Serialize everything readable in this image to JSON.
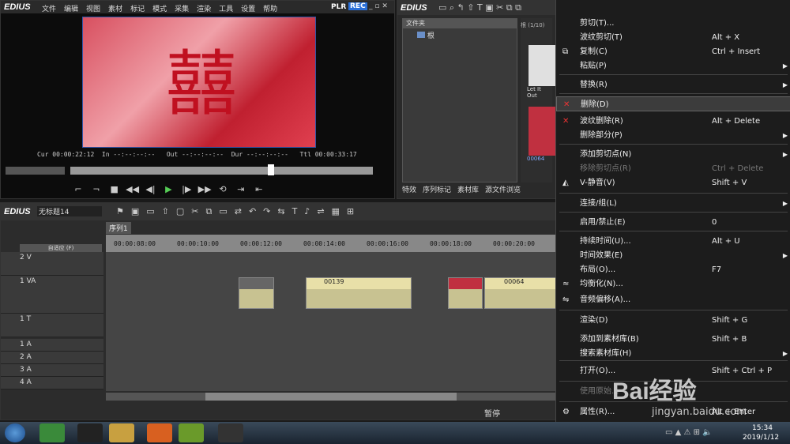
{
  "app": {
    "name": "EDIUS",
    "menus": [
      "文件",
      "编辑",
      "视图",
      "素材",
      "标记",
      "模式",
      "采集",
      "渲染",
      "工具",
      "设置",
      "帮助"
    ],
    "mode_plr": "PLR",
    "mode_rec": "REC"
  },
  "player": {
    "cur_label": "Cur",
    "cur": "00:00:22:12",
    "in_label": "In",
    "in": "--:--:--:--",
    "out_label": "Out",
    "out": "--:--:--:--",
    "dur_label": "Dur",
    "dur": "--:--:--:--",
    "ttl_label": "Ttl",
    "ttl": "00:00:33:17"
  },
  "bin": {
    "title": "EDIUS",
    "folder_header": "文件夹",
    "root": "根",
    "clip_header": "根 (1/10)",
    "clip1_label": "Let It Out",
    "clip2_label": "00064",
    "tabs": [
      "特效",
      "序列标记",
      "素材库",
      "源文件浏览"
    ]
  },
  "timeline": {
    "title": "EDIUS",
    "project": "无标题14",
    "sequence_tab": "序列1",
    "zoom": "自适应 (F)",
    "ruler": [
      "00:00:08:00",
      "00:00:10:00",
      "00:00:12:00",
      "00:00:14:00",
      "00:00:16:00",
      "00:00:18:00",
      "00:00:20:00"
    ],
    "tracks": [
      {
        "name": "2 V"
      },
      {
        "name": "1 VA"
      },
      {
        "name": "1 T"
      },
      {
        "name": "1 A"
      },
      {
        "name": "2 A"
      },
      {
        "name": "3 A"
      },
      {
        "name": "4 A"
      }
    ],
    "clips": [
      {
        "label": "00139"
      },
      {
        "label": "00064"
      }
    ],
    "status": "暂停"
  },
  "context_menu": {
    "items": [
      {
        "label": "剪切(T)...",
        "shortcut": "",
        "icon": "",
        "dis": false,
        "arrow": false
      },
      {
        "label": "波纹剪切(T)",
        "shortcut": "Alt + X",
        "icon": "",
        "dis": false,
        "arrow": false
      },
      {
        "label": "复制(C)",
        "shortcut": "Ctrl + Insert",
        "icon": "copy",
        "dis": false,
        "arrow": false
      },
      {
        "label": "粘贴(P)",
        "shortcut": "",
        "icon": "",
        "dis": false,
        "arrow": true
      },
      {
        "label": "替换(R)",
        "shortcut": "",
        "icon": "",
        "dis": false,
        "arrow": true
      },
      {
        "label": "删除(D)",
        "shortcut": "",
        "icon": "delete",
        "dis": false,
        "arrow": false
      },
      {
        "label": "波纹删除(R)",
        "shortcut": "Alt + Delete",
        "icon": "ripple",
        "dis": false,
        "arrow": false
      },
      {
        "label": "删除部分(P)",
        "shortcut": "",
        "icon": "",
        "dis": false,
        "arrow": true
      },
      {
        "label": "添加剪切点(N)",
        "shortcut": "",
        "icon": "",
        "dis": false,
        "arrow": true
      },
      {
        "label": "移除剪切点(R)",
        "shortcut": "Ctrl + Delete",
        "icon": "",
        "dis": true,
        "arrow": false
      },
      {
        "label": "V-静音(V)",
        "shortcut": "Shift + V",
        "icon": "mute",
        "dis": false,
        "arrow": false
      },
      {
        "label": "连接/组(L)",
        "shortcut": "",
        "icon": "",
        "dis": false,
        "arrow": true
      },
      {
        "label": "启用/禁止(E)",
        "shortcut": "0",
        "icon": "",
        "dis": false,
        "arrow": false
      },
      {
        "label": "持续时间(U)...",
        "shortcut": "Alt + U",
        "icon": "",
        "dis": false,
        "arrow": false
      },
      {
        "label": "时间效果(E)",
        "shortcut": "",
        "icon": "",
        "dis": false,
        "arrow": true
      },
      {
        "label": "布局(O)...",
        "shortcut": "F7",
        "icon": "",
        "dis": false,
        "arrow": false
      },
      {
        "label": "均衡化(N)...",
        "shortcut": "",
        "icon": "eq",
        "dis": false,
        "arrow": false
      },
      {
        "label": "音频偏移(A)...",
        "shortcut": "",
        "icon": "audio",
        "dis": false,
        "arrow": false
      },
      {
        "label": "渲染(D)",
        "shortcut": "Shift + G",
        "icon": "",
        "dis": false,
        "arrow": false
      },
      {
        "label": "添加到素材库(B)",
        "shortcut": "Shift + B",
        "icon": "",
        "dis": false,
        "arrow": false
      },
      {
        "label": "搜索素材库(H)",
        "shortcut": "",
        "icon": "",
        "dis": false,
        "arrow": true
      },
      {
        "label": "打开(O)...",
        "shortcut": "Shift + Ctrl + P",
        "icon": "",
        "dis": false,
        "arrow": false
      },
      {
        "label": "使用原始...",
        "shortcut": "",
        "icon": "",
        "dis": true,
        "arrow": false
      },
      {
        "label": "属性(R)...",
        "shortcut": "Alt + Enter",
        "icon": "props",
        "dis": false,
        "arrow": false
      }
    ]
  },
  "taskbar": {
    "time": "15:34",
    "date": "2019/1/12"
  },
  "watermark": {
    "text": "Bai经验",
    "url": "jingyan.baidu.com"
  },
  "colors": {
    "accent": "#3a6ab0",
    "context_bg": "#1c1c1c",
    "highlight": "#3c3c3c"
  }
}
